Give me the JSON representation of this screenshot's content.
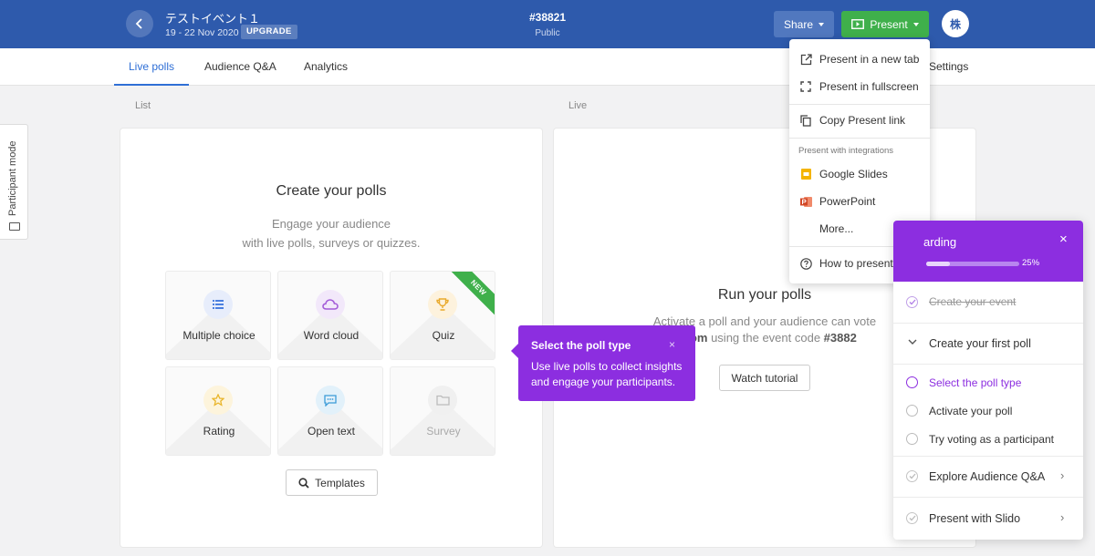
{
  "header": {
    "event_title": "テストイベント１",
    "event_dates": "19 - 22 Nov 2020",
    "upgrade_label": "UPGRADE",
    "event_code": "#38821",
    "event_visibility": "Public",
    "share_label": "Share",
    "present_label": "Present",
    "avatar_initial": "株"
  },
  "tabs": [
    {
      "label": "Live polls",
      "active": true
    },
    {
      "label": "Audience Q&A",
      "active": false
    },
    {
      "label": "Analytics",
      "active": false
    }
  ],
  "settings_label": "Settings",
  "participant_mode_label": "Participant mode",
  "list_section": {
    "label": "List",
    "title": "Create your polls",
    "subtitle_line1": "Engage your audience",
    "subtitle_line2": "with live polls, surveys or quizzes.",
    "poll_types": [
      {
        "label": "Multiple choice",
        "icon": "list-icon",
        "color": "#4a7fe0"
      },
      {
        "label": "Word cloud",
        "icon": "cloud-icon",
        "color": "#a35bd8"
      },
      {
        "label": "Quiz",
        "icon": "trophy-icon",
        "color": "#e9a92a",
        "badge": "NEW"
      },
      {
        "label": "Rating",
        "icon": "star-icon",
        "color": "#e9b52a"
      },
      {
        "label": "Open text",
        "icon": "speech-bubble-icon",
        "color": "#3b9bd8"
      },
      {
        "label": "Survey",
        "icon": "folder-icon",
        "color": "#bbbbbb",
        "disabled": true
      }
    ],
    "templates_label": "Templates"
  },
  "live_section": {
    "label": "Live",
    "title": "Run your polls",
    "subtitle_line1": "Activate a poll and your audience can vote",
    "subtitle_line2_pre": "o.com",
    "subtitle_line2_mid": " using the event code ",
    "subtitle_line2_code": "#3882",
    "watch_label": "Watch tutorial"
  },
  "tooltip": {
    "title": "Select the poll type",
    "close": "×",
    "body": "Use live polls to collect insights and engage your participants."
  },
  "present_menu": {
    "items_top": [
      "Present in a new tab",
      "Present in fullscreen"
    ],
    "copy_link": "Copy Present link",
    "integrations_heading": "Present with integrations",
    "integrations": [
      "Google Slides",
      "PowerPoint",
      "More..."
    ],
    "how_to": "How to present"
  },
  "onboarding": {
    "title": "arding",
    "progress": 25,
    "progress_label": "25%",
    "close": "×",
    "steps": {
      "done": "Create your event",
      "current_group": "Create your first poll",
      "substeps": [
        "Select the poll type",
        "Activate your poll",
        "Try voting as a participant"
      ],
      "explore": "Explore Audience Q&A",
      "present": "Present with Slido"
    }
  },
  "colors": {
    "header_bg": "#2e5aac",
    "accent_green": "#3fb04b",
    "accent_purple": "#8c2ee0",
    "tab_active": "#2f6fd6"
  }
}
